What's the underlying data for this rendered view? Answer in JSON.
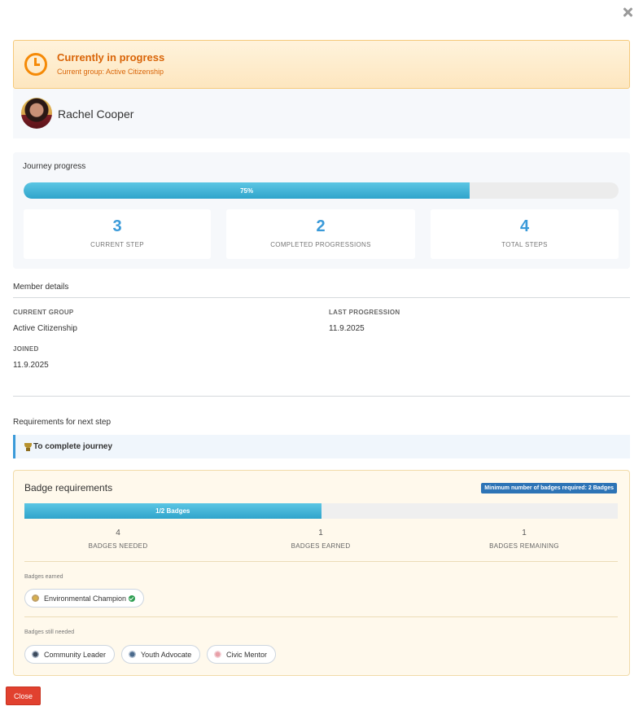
{
  "status": {
    "title": "Currently in progress",
    "subtitle": "Current group: Active Citizenship",
    "icon": "clock-icon"
  },
  "member": {
    "name": "Rachel Cooper"
  },
  "journey": {
    "title": "Journey progress",
    "progress_percent": 75,
    "progress_label": "75%",
    "stats": [
      {
        "value": "3",
        "label": "CURRENT STEP"
      },
      {
        "value": "2",
        "label": "COMPLETED PROGRESSIONS"
      },
      {
        "value": "4",
        "label": "TOTAL STEPS"
      }
    ]
  },
  "member_details": {
    "title": "Member details",
    "current_group_label": "CURRENT GROUP",
    "current_group_value": "Active Citizenship",
    "last_progression_label": "LAST PROGRESSION",
    "last_progression_value": "11.9.2025",
    "joined_label": "JOINED",
    "joined_value": "11.9.2025"
  },
  "requirements": {
    "title": "Requirements for next step",
    "next_step": "To complete journey",
    "icon": "trophy-icon"
  },
  "badges": {
    "title": "Badge requirements",
    "minimum_label": "Minimum number of badges required: 2 Badges",
    "progress_fraction": 0.5,
    "progress_label": "1/2 Badges",
    "stats": [
      {
        "value": "4",
        "label": "BADGES NEEDED"
      },
      {
        "value": "1",
        "label": "BADGES EARNED"
      },
      {
        "value": "1",
        "label": "BADGES REMAINING"
      }
    ],
    "earned_title": "Badges earned",
    "earned": [
      {
        "name": "Environmental Champion",
        "color": "#d8b04a"
      }
    ],
    "needed_title": "Badges still needed",
    "needed": [
      {
        "name": "Community Leader",
        "color": "#3c4a5c"
      },
      {
        "name": "Youth Advocate",
        "color": "#4a6a8c"
      },
      {
        "name": "Civic Mentor",
        "color": "#e8a0a8"
      }
    ]
  },
  "footer": {
    "close_label": "Close"
  },
  "colors": {
    "accent": "#3a9ad9",
    "warning": "#d96407",
    "danger": "#e1412f",
    "success": "#2e9e52"
  }
}
